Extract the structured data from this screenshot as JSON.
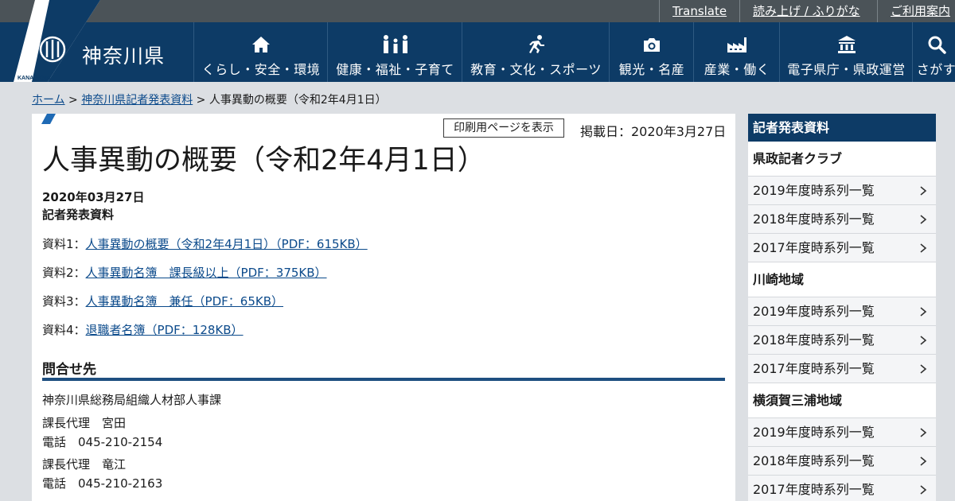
{
  "utility": {
    "translate": "Translate",
    "read_aloud": "読み上げ / ふりがな",
    "guide": "ご利用案内"
  },
  "header": {
    "site_name": "神奈川県",
    "logo_sub": "KANAGAWA",
    "nav": [
      {
        "label": "くらし・安全・環境",
        "icon": "house-icon"
      },
      {
        "label": "健康・福祉・子育て",
        "icon": "family-icon"
      },
      {
        "label": "教育・文化・スポーツ",
        "icon": "runner-icon"
      },
      {
        "label": "観光・名産",
        "icon": "camera-icon"
      },
      {
        "label": "産業・働く",
        "icon": "factory-icon"
      },
      {
        "label": "電子県庁・県政運営",
        "icon": "government-icon"
      },
      {
        "label": "さがす",
        "icon": "search-icon"
      }
    ]
  },
  "breadcrumb": {
    "home": "ホーム",
    "sep1": " > ",
    "parent": "神奈川県記者発表資料",
    "sep2": " > ",
    "current": "人事異動の概要（令和2年4月1日）"
  },
  "main": {
    "print_label": "印刷用ページを表示",
    "posted_date": "掲載日：2020年3月27日",
    "title": "人事異動の概要（令和2年4月1日）",
    "date": "2020年03月27日",
    "type": "記者発表資料",
    "documents": [
      {
        "prefix": "資料1：",
        "link": "人事異動の概要（令和2年4月1日）（PDF：615KB）"
      },
      {
        "prefix": "資料2：",
        "link": "人事異動名簿　課長級以上（PDF：375KB）"
      },
      {
        "prefix": "資料3：",
        "link": "人事異動名簿　兼任（PDF：65KB）"
      },
      {
        "prefix": "資料4：",
        "link": "退職者名簿（PDF：128KB）"
      }
    ],
    "contact": {
      "heading": "問合せ先",
      "department": "神奈川県総務局組織人材部人事課",
      "person1": "課長代理　宮田",
      "phone1": "電話　045-210-2154",
      "person2": "課長代理　竜江",
      "phone2": "電話　045-210-2163"
    }
  },
  "sidebar": {
    "heading": "記者発表資料",
    "sections": [
      {
        "title": "県政記者クラブ",
        "links": [
          "2019年度時系列一覧",
          "2018年度時系列一覧",
          "2017年度時系列一覧"
        ]
      },
      {
        "title": "川崎地域",
        "links": [
          "2019年度時系列一覧",
          "2018年度時系列一覧",
          "2017年度時系列一覧"
        ]
      },
      {
        "title": "横須賀三浦地域",
        "links": [
          "2019年度時系列一覧",
          "2018年度時系列一覧",
          "2017年度時系列一覧"
        ]
      }
    ]
  },
  "colors": {
    "header_navy": "#0d3b66",
    "utility_gray": "#4b5358",
    "link_blue": "#0b4a8b",
    "page_bg": "#dcdfe3"
  }
}
